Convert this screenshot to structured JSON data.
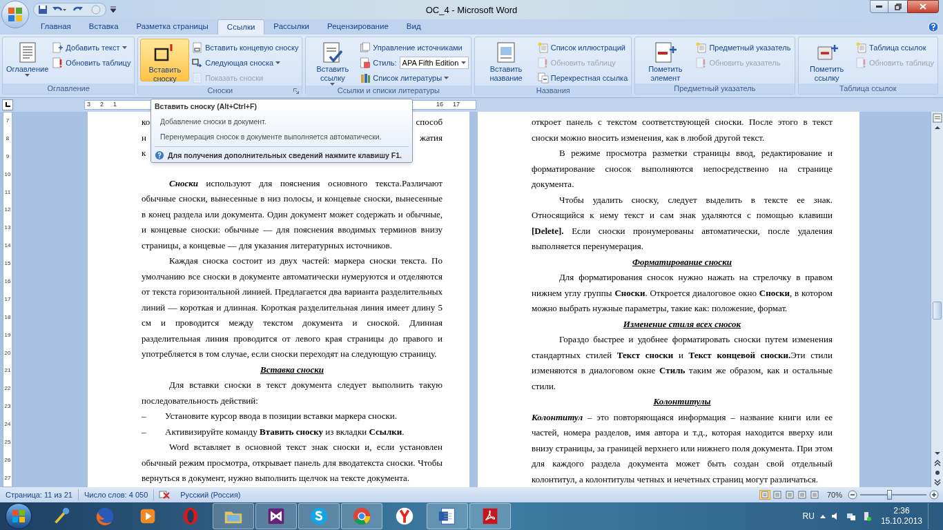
{
  "window": {
    "title": "ОС_4 - Microsoft Word"
  },
  "tabs": [
    {
      "label": "Главная",
      "selected": false
    },
    {
      "label": "Вставка",
      "selected": false
    },
    {
      "label": "Разметка страницы",
      "selected": false
    },
    {
      "label": "Ссылки",
      "selected": true
    },
    {
      "label": "Рассылки",
      "selected": false
    },
    {
      "label": "Рецензирование",
      "selected": false
    },
    {
      "label": "Вид",
      "selected": false
    }
  ],
  "ribbon_groups": [
    {
      "label": "Оглавление",
      "launcher": false,
      "big": {
        "label": "Оглавление",
        "dropdown": true,
        "highlighted": false
      },
      "small": [
        {
          "label": "Добавить текст",
          "dropdown": true,
          "disabled": false
        },
        {
          "label": "Обновить таблицу",
          "dropdown": false,
          "disabled": false
        }
      ]
    },
    {
      "label": "Сноски",
      "launcher": true,
      "big": {
        "label": "Вставить сноску",
        "dropdown": false,
        "highlighted": true
      },
      "small": [
        {
          "label": "Вставить концевую сноску",
          "dropdown": false,
          "disabled": false
        },
        {
          "label": "Следующая сноска",
          "dropdown": true,
          "disabled": false
        },
        {
          "label": "Показать сноски",
          "dropdown": false,
          "disabled": true
        }
      ]
    },
    {
      "label": "Ссылки и списки литературы",
      "launcher": false,
      "big": {
        "label": "Вставить ссылку",
        "dropdown": true,
        "highlighted": false
      },
      "small": [
        {
          "label": "Управление источниками",
          "dropdown": false,
          "disabled": false
        },
        {
          "label": "Стиль:",
          "dropdown": false,
          "disabled": false,
          "select": "APA Fifth Edition"
        },
        {
          "label": "Список литературы",
          "dropdown": true,
          "disabled": false
        }
      ]
    },
    {
      "label": "Названия",
      "launcher": false,
      "big": {
        "label": "Вставить название",
        "dropdown": false,
        "highlighted": false
      },
      "small": [
        {
          "label": "Список иллюстраций",
          "dropdown": false,
          "disabled": false
        },
        {
          "label": "Обновить таблицу",
          "dropdown": false,
          "disabled": true
        },
        {
          "label": "Перекрестная ссылка",
          "dropdown": false,
          "disabled": false
        }
      ]
    },
    {
      "label": "Предметный указатель",
      "launcher": false,
      "big": {
        "label": "Пометить элемент",
        "dropdown": false,
        "highlighted": false
      },
      "small": [
        {
          "label": "Предметный указатель",
          "dropdown": false,
          "disabled": false
        },
        {
          "label": "Обновить указатель",
          "dropdown": false,
          "disabled": true
        }
      ]
    },
    {
      "label": "Таблица ссылок",
      "launcher": false,
      "big": {
        "label": "Пометить ссылку",
        "dropdown": false,
        "highlighted": false
      },
      "small": [
        {
          "label": "Таблица ссылок",
          "dropdown": false,
          "disabled": false
        },
        {
          "label": "Обновить таблицу",
          "dropdown": false,
          "disabled": true
        }
      ]
    }
  ],
  "ruler": {
    "left_labels": [
      "3",
      "2",
      "1"
    ],
    "right_labels": [
      "16",
      "17"
    ],
    "vertical_labels": [
      "7",
      "8",
      "9",
      "10",
      "11",
      "12",
      "13",
      "14",
      "15",
      "16",
      "17",
      "18",
      "19",
      "20",
      "21",
      "22",
      "23",
      "24",
      "25",
      "26",
      "27"
    ]
  },
  "tooltip": {
    "title": "Вставить сноску (Alt+Ctrl+F)",
    "lines": [
      "Добавление сноски в документ.",
      "Перенумерация сносок в документе выполняется автоматически."
    ],
    "help": "Для получения дополнительных сведений нажмите клавишу F1."
  },
  "pages": [
    {
      "blocks": [
        {
          "kind": "fragment",
          "left": "ко",
          "right": "способ"
        },
        {
          "kind": "fragment",
          "left": "н",
          "right": "жатия"
        },
        {
          "kind": "fragment",
          "left": "к"
        },
        {
          "kind": "para",
          "indent": true,
          "lead": "Сноски",
          "text": " используют для пояснения основного текста.Различают обычные сноски, вынесенные в низ полосы, и концевые сноски, вынесенные в конец раздела или документа. Один документ может содержать и обычные, и концевые сноски: обычные — для пояснения вводимых терминов внизу страницы, а концевые — для указания литературных источников."
        },
        {
          "kind": "para",
          "indent": true,
          "text": "Каждая сноска состоит из двух частей: маркера сноски текста. По умолчанию все сноски в документе автоматически нумеруются и отделяются от текста горизонтальной линией. Предлагается два варианта разделительных линий — короткая и длинная. Короткая разделительная линия имеет длину 5 см и проводится между текстом документа и сноской. Длинная разделительная линия проводится от левого края страницы до правого и употребляется в том случае, если сноски переходят на следующую страницу."
        },
        {
          "kind": "heading",
          "text": "Вставка сноски"
        },
        {
          "kind": "para",
          "indent": true,
          "text": "Для вставки сноски в текст документа следует выполнить такую последовательность действий:"
        },
        {
          "kind": "bullet",
          "marker": "–",
          "text": "Установите курсор ввода в позиции вставки маркера сноски."
        },
        {
          "kind": "bullet",
          "marker": "–",
          "text": "Активизируйте команду **Втавить сноску** из вкладки **Ссылки**."
        },
        {
          "kind": "para",
          "indent": true,
          "text": "Word вставляет в основной текст знак сноски и, если установлен обычный режим просмотра, открывает панель для вводатекста сноски. Чтобы вернуться в документ, нужно выполнить щелчок на тексте документа."
        }
      ]
    },
    {
      "blocks": [
        {
          "kind": "para",
          "indent": false,
          "text": "откроет панель с текстом соответствующей сноски. После этого в текст сноски можно вносить изменения, как в любой другой текст."
        },
        {
          "kind": "para",
          "indent": true,
          "text": "В режиме просмотра разметки страницы ввод, редактирование и форматирование сносок выполняются непосредственно на странице документа."
        },
        {
          "kind": "para",
          "indent": true,
          "text": "Чтобы удалить сноску, следует выделить в тексте ее знак. Относящийся к нему текст и сам знак удаляются с помощью клавиши **[Delete].** Если сноски пронумерованы автоматически, после удаления выполняется перенумерация."
        },
        {
          "kind": "heading",
          "text": "Форматирование сноски"
        },
        {
          "kind": "para",
          "indent": true,
          "text": "Для форматирования сносок нужно нажать на стрелочку в правом нижнем углу группы **Сноски**. Откроется диалоговое окно **Сноски**, в котором можно выбрать нужные параметры, такие как: положение, формат."
        },
        {
          "kind": "heading",
          "text": "Изменение стиля всех сносок"
        },
        {
          "kind": "para",
          "indent": true,
          "text": "Гораздо быстрее и удобнее форматировать сноски путем изменения стандартных стилей **Текст сноски** и **Текст концевой сноски.**Эти стили изменяются в диалоговом окне **Стиль** таким же образом, как и остальные стили."
        },
        {
          "kind": "heading",
          "text": "Колонтитулы"
        },
        {
          "kind": "para",
          "indent": false,
          "lead": "Колонтитул",
          "text": " – это повторяющаяся информация – название книги или ее частей, номера разделов, имя автора и т.д., которая находится вверху или внизу страницы, за границей верхнего или нижнего поля документа. При этом для каждого раздела документа может быть создан свой отдельный колонтитул, а колонтитулы четных и нечетных страниц могут различаться."
        }
      ]
    }
  ],
  "status_bar": {
    "page": "Страница: 11 из 21",
    "words": "Число слов: 4 050",
    "language": "Русский (Россия)",
    "zoom": "70%",
    "level": 0.44
  },
  "taskbar": {
    "apps": [
      {
        "kind": "wand",
        "selected": false
      },
      {
        "kind": "firefox",
        "selected": false
      },
      {
        "kind": "media",
        "selected": false
      },
      {
        "kind": "opera",
        "selected": false
      },
      {
        "kind": "folder",
        "selected": true
      },
      {
        "kind": "vs",
        "selected": true
      },
      {
        "kind": "skype",
        "selected": true
      },
      {
        "kind": "chrome",
        "selected": true
      },
      {
        "kind": "yandex",
        "selected": false
      },
      {
        "kind": "word",
        "selected": true
      },
      {
        "kind": "pdf",
        "selected": true
      }
    ],
    "language": "RU",
    "time": "2:36",
    "date": "15.10.2013"
  }
}
